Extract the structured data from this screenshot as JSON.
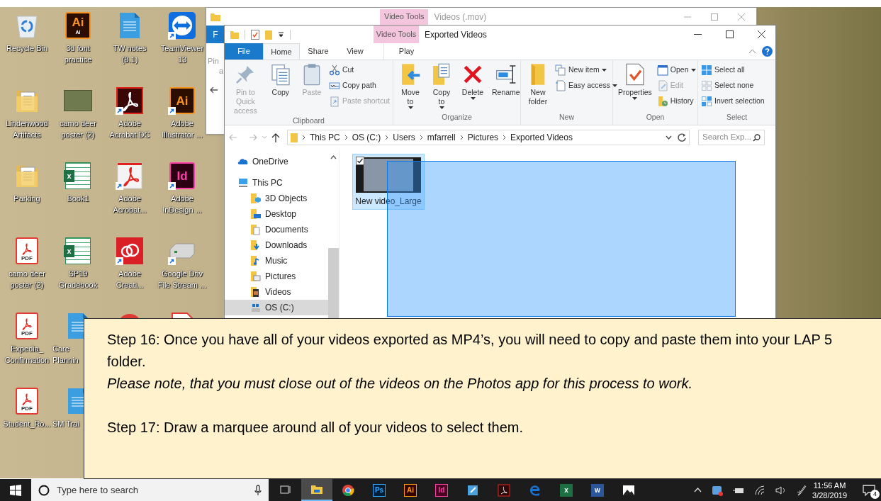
{
  "desktop_icons": [
    {
      "label": "Recycle Bin",
      "kind": "recycle",
      "shortcut": false
    },
    {
      "label": "3d font practice",
      "kind": "ai",
      "glyph": "Ai",
      "sub_glyph": "AI",
      "shortcut": false
    },
    {
      "label": "TW notes (8.1)",
      "kind": "doc",
      "shortcut": false
    },
    {
      "label": "TeamViewer 13",
      "kind": "teamviewer",
      "shortcut": true
    },
    {
      "label": "Lindenwood Artifacts",
      "kind": "folder",
      "shortcut": false
    },
    {
      "label": "camo deer poster (2)",
      "kind": "photo",
      "shortcut": false
    },
    {
      "label": "Adobe Acrobat DC",
      "kind": "acrobat",
      "shortcut": true
    },
    {
      "label": "Adobe Illustrator ...",
      "kind": "ai",
      "glyph": "Ai",
      "shortcut": true
    },
    {
      "label": "Parking",
      "kind": "folder",
      "shortcut": false
    },
    {
      "label": "Book1",
      "kind": "excel",
      "glyph": "x",
      "shortcut": false
    },
    {
      "label": "Adobe Acrobat...",
      "kind": "acrobat-page",
      "shortcut": true
    },
    {
      "label": "Adobe InDesign ...",
      "kind": "id",
      "glyph": "Id",
      "shortcut": true
    },
    {
      "label": "camo deer poster (2)",
      "kind": "pdf",
      "glyph": "PDF",
      "shortcut": false
    },
    {
      "label": "SP19 Gradebook",
      "kind": "excel",
      "glyph": "x",
      "shortcut": false
    },
    {
      "label": "Adobe Creati...",
      "kind": "cc",
      "shortcut": true
    },
    {
      "label": "Google Driv File Stream ...",
      "kind": "drive",
      "shortcut": true
    },
    {
      "label": "Expedia_ Confirmation",
      "kind": "pdf",
      "glyph": "PDF",
      "shortcut": false
    },
    {
      "label": "Care Plannin",
      "kind": "doc",
      "shortcut": false
    },
    {
      "kind": "red-circle"
    },
    {
      "kind": "page"
    },
    {
      "label": "Student_Ro...",
      "kind": "pdf",
      "glyph": "PDF",
      "shortcut": false
    },
    {
      "label": "SM Trai",
      "kind": "doc",
      "shortcut": false
    }
  ],
  "back_window": {
    "title": "Videos (.mov)",
    "context_tab": "Video Tools",
    "file_tab": "F",
    "ribbon_texts": [
      "Pin",
      "a"
    ]
  },
  "window": {
    "title": "Exported Videos",
    "context_tab": "Video Tools",
    "tabs": [
      {
        "label": "File",
        "kind": "file",
        "selected": false
      },
      {
        "label": "Home",
        "kind": "normal",
        "selected": true
      },
      {
        "label": "Share",
        "kind": "normal",
        "selected": false
      },
      {
        "label": "View",
        "kind": "normal",
        "selected": false
      },
      {
        "label": "Play",
        "kind": "context",
        "selected": false
      }
    ],
    "ribbon": [
      {
        "label": "Clipboard",
        "columns": [
          [
            {
              "label": "Pin to Quick access",
              "kind": "large",
              "disabled": true,
              "menu": false
            }
          ],
          [
            {
              "label": "Copy",
              "kind": "large",
              "disabled": false,
              "menu": false
            }
          ],
          [
            {
              "label": "Paste",
              "kind": "large",
              "disabled": true,
              "menu": false
            }
          ],
          [
            {
              "label": "Cut",
              "kind": "small",
              "disabled": false,
              "menu": false
            },
            {
              "label": "Copy path",
              "kind": "small",
              "disabled": false,
              "menu": false
            },
            {
              "label": "Paste shortcut",
              "kind": "small",
              "disabled": true,
              "menu": false
            }
          ]
        ]
      },
      {
        "label": "Organize",
        "columns": [
          [
            {
              "label": "Move to",
              "kind": "large",
              "disabled": false,
              "menu": true
            }
          ],
          [
            {
              "label": "Copy to",
              "kind": "large",
              "disabled": false,
              "menu": true
            }
          ],
          [
            {
              "label": "Delete",
              "kind": "large",
              "disabled": false,
              "menu": true
            }
          ],
          [
            {
              "label": "Rename",
              "kind": "large",
              "disabled": false,
              "menu": false
            }
          ]
        ]
      },
      {
        "label": "New",
        "columns": [
          [
            {
              "label": "New folder",
              "kind": "large",
              "disabled": false,
              "menu": false
            }
          ],
          [
            {
              "label": "New item",
              "kind": "small",
              "disabled": false,
              "menu": true
            },
            {
              "label": "Easy access",
              "kind": "small",
              "disabled": false,
              "menu": true
            }
          ]
        ]
      },
      {
        "label": "Open",
        "columns": [
          [
            {
              "label": "Properties",
              "kind": "large",
              "disabled": false,
              "menu": true
            }
          ],
          [
            {
              "label": "Open",
              "kind": "small",
              "disabled": false,
              "menu": true
            },
            {
              "label": "Edit",
              "kind": "small",
              "disabled": true,
              "menu": false
            },
            {
              "label": "History",
              "kind": "small",
              "disabled": false,
              "menu": false
            }
          ]
        ]
      },
      {
        "label": "Select",
        "columns": [
          [
            {
              "label": "Select all",
              "kind": "small",
              "disabled": false,
              "menu": false
            },
            {
              "label": "Select none",
              "kind": "small",
              "disabled": false,
              "menu": false
            },
            {
              "label": "Invert selection",
              "kind": "small",
              "disabled": false,
              "menu": false
            }
          ]
        ]
      }
    ],
    "address": {
      "crumbs": [
        "This PC",
        "OS (C:)",
        "Users",
        "mfarrell",
        "Pictures",
        "Exported Videos"
      ],
      "search_placeholder": "Search Exp..."
    },
    "nav": [
      {
        "label": "OneDrive",
        "selected": false
      },
      {
        "label": "This PC",
        "selected": false,
        "children": [
          {
            "label": "3D Objects",
            "selected": false
          },
          {
            "label": "Desktop",
            "selected": false
          },
          {
            "label": "Documents",
            "selected": false
          },
          {
            "label": "Downloads",
            "selected": false
          },
          {
            "label": "Music",
            "selected": false
          },
          {
            "label": "Pictures",
            "selected": false
          },
          {
            "label": "Videos",
            "selected": false
          },
          {
            "label": "OS (C:)",
            "selected": true
          }
        ]
      }
    ],
    "files": [
      {
        "label": "New video_Large",
        "selected": true,
        "checked": true
      }
    ]
  },
  "instructions": [
    {
      "text": "Step 16: Once you have all of your videos exported as MP4’s, you will need to copy and paste them into your LAP 5 folder.",
      "kind": "step"
    },
    {
      "text": "Please note, that you must close out of the videos on the Photos app for this process to work.",
      "kind": "note"
    },
    {
      "text": "Step 17: Draw a marquee around all of your videos to select them.",
      "kind": "step"
    }
  ],
  "taskbar": {
    "search_placeholder": "Type here to search",
    "apps": [
      {
        "kind": "taskview",
        "active": false
      },
      {
        "kind": "explorer",
        "active": true
      },
      {
        "kind": "chrome",
        "active": false
      },
      {
        "kind": "ps",
        "glyph": "Ps",
        "active": false
      },
      {
        "kind": "ai",
        "glyph": "Ai",
        "active": false
      },
      {
        "kind": "id",
        "glyph": "Id",
        "active": false
      },
      {
        "kind": "notes",
        "active": false
      },
      {
        "kind": "acrobat",
        "active": false
      },
      {
        "kind": "edge",
        "active": false
      },
      {
        "kind": "excel",
        "glyph": "x",
        "active": false
      },
      {
        "kind": "word",
        "glyph": "w",
        "active": false
      },
      {
        "kind": "photos",
        "active": false
      }
    ],
    "time": "11:56 AM",
    "date": "3/28/2019",
    "notifications": "4"
  }
}
